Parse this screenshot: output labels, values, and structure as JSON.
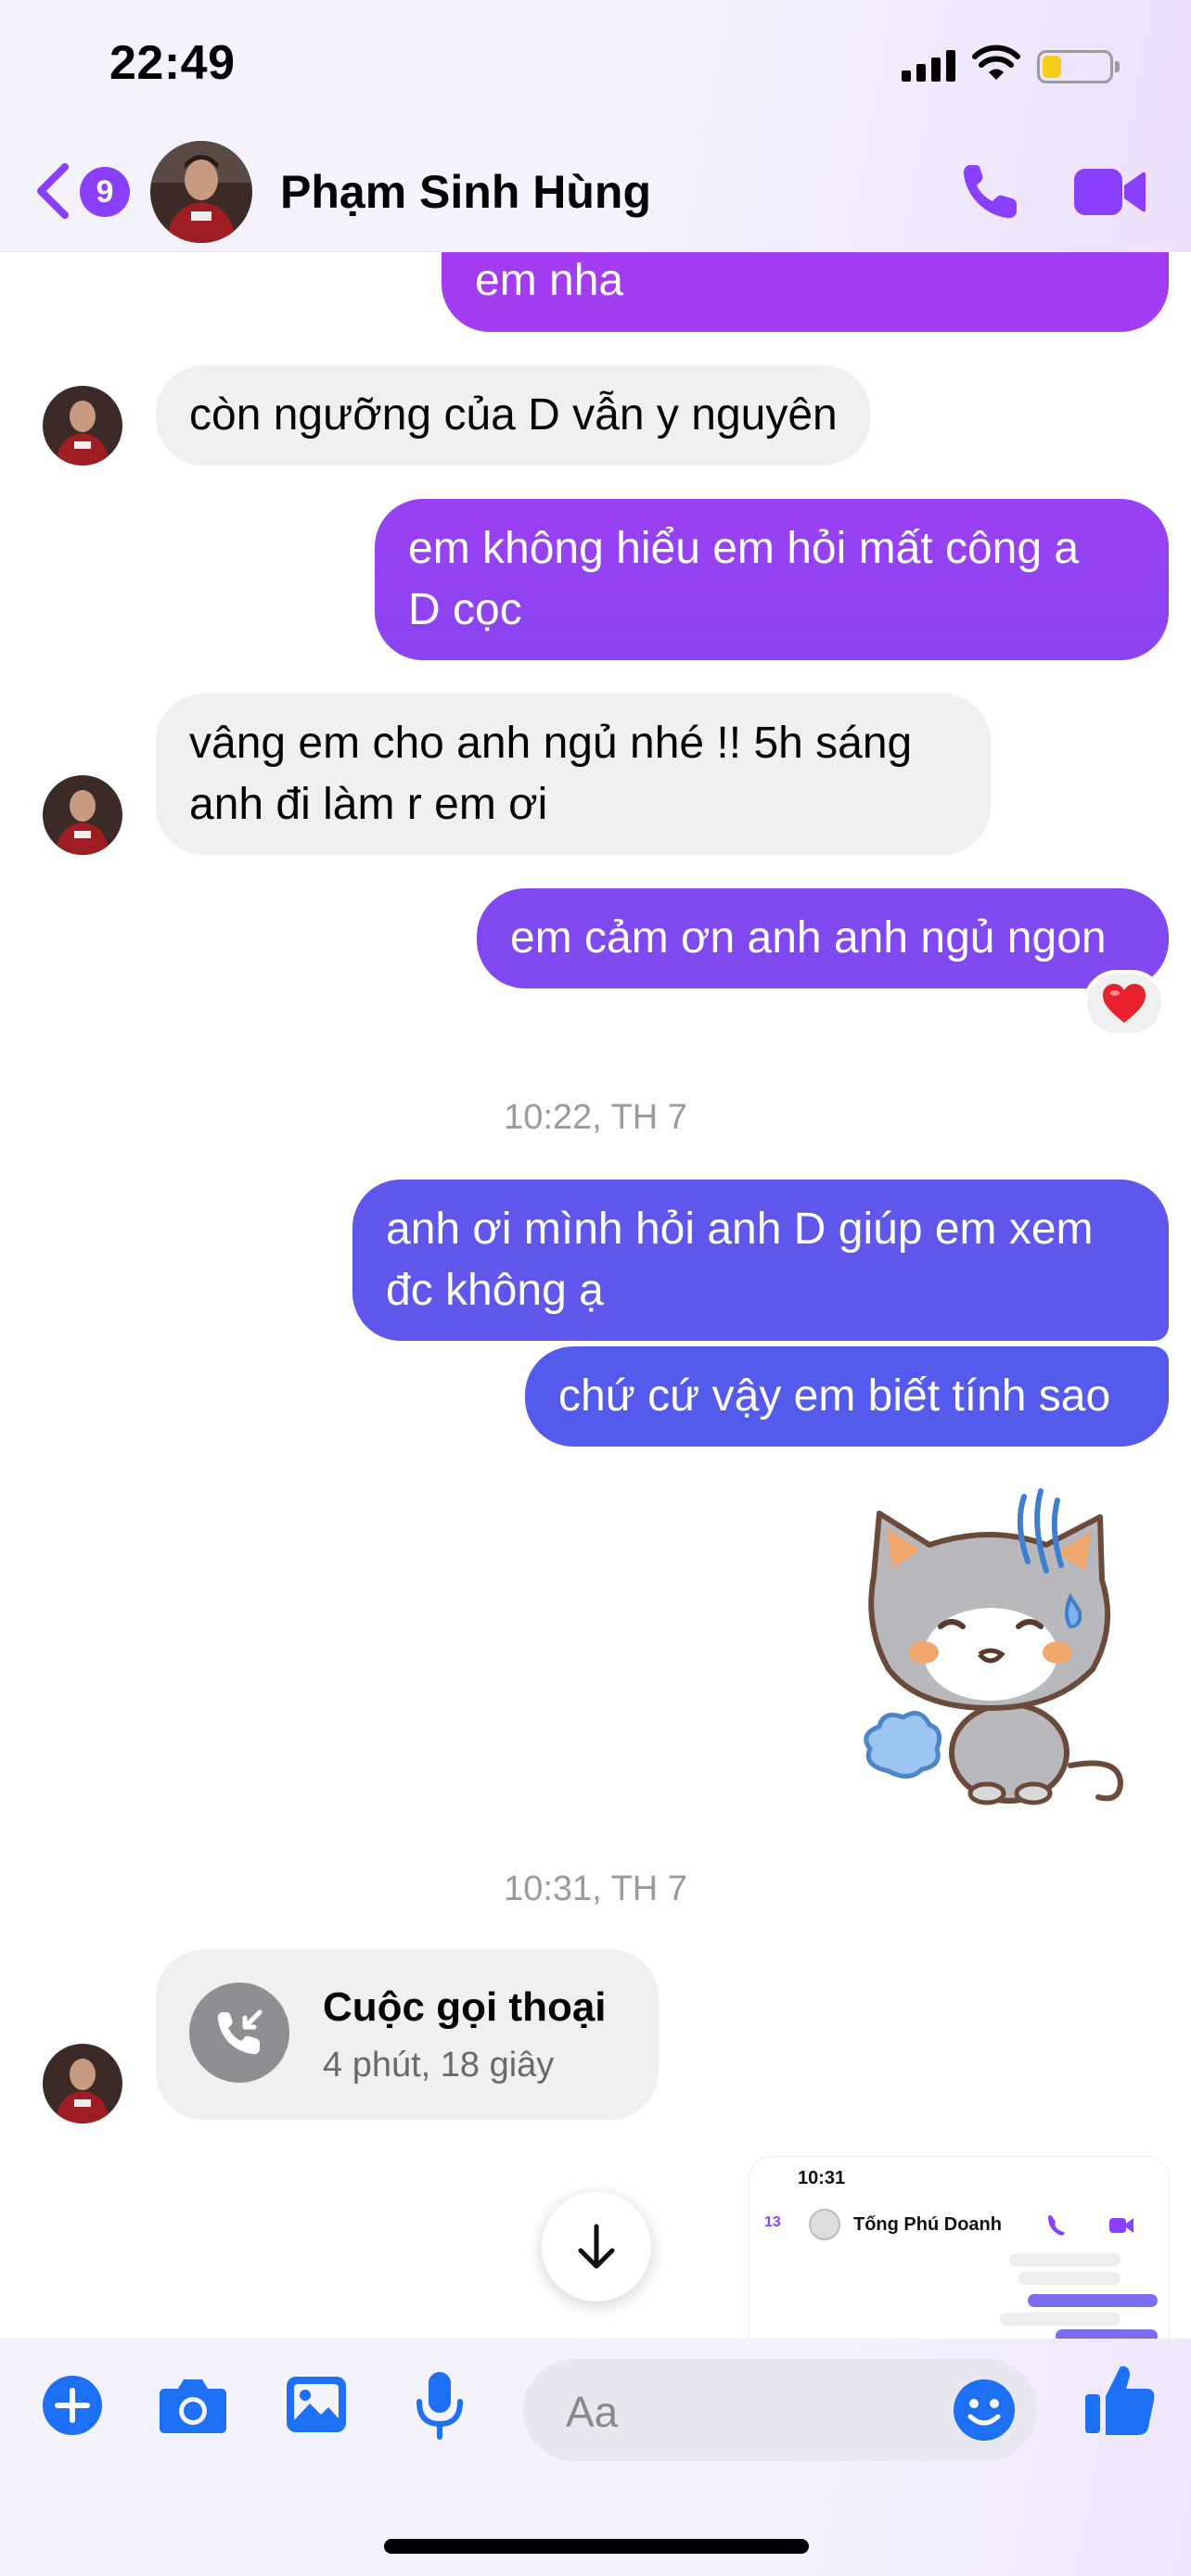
{
  "status_bar": {
    "time": "22:49"
  },
  "header": {
    "back_badge": "9",
    "contact_name": "Phạm Sinh Hùng"
  },
  "messages": [
    {
      "direction": "out",
      "text": "em nha"
    },
    {
      "direction": "in",
      "text": "còn ngưỡng của D vẫn y nguyên"
    },
    {
      "direction": "out",
      "lines": [
        "em không hiểu em hỏi mất công a",
        "D cọc"
      ]
    },
    {
      "direction": "in",
      "lines": [
        "vâng em cho anh ngủ nhé !! 5h sáng",
        "anh đi làm r em ơi"
      ]
    },
    {
      "direction": "out",
      "text": "em cảm ơn anh anh ngủ ngon",
      "reaction": "❤️"
    },
    {
      "timestamp": "10:22, TH 7"
    },
    {
      "direction": "out",
      "lines": [
        "anh ơi mình hỏi anh D giúp em xem",
        "đc không ạ"
      ]
    },
    {
      "direction": "out",
      "text": "chứ cứ vậy em biết tính sao"
    },
    {
      "direction": "out",
      "sticker": "sweating-cat-sticker"
    },
    {
      "timestamp": "10:31, TH 7"
    },
    {
      "direction": "in",
      "call": {
        "title": "Cuộc gọi thoại",
        "duration": "4 phút, 18 giây"
      }
    }
  ],
  "thumbnail": {
    "time": "10:31",
    "badge": "13",
    "name": "Tống Phú Doanh"
  },
  "composer": {
    "placeholder": "Aa"
  },
  "colors": {
    "accent": "#8a3ffc",
    "bubble_in": "#f0f0f0",
    "gradient_top": "#a43cf2",
    "gradient_bottom": "#4f5bea"
  }
}
